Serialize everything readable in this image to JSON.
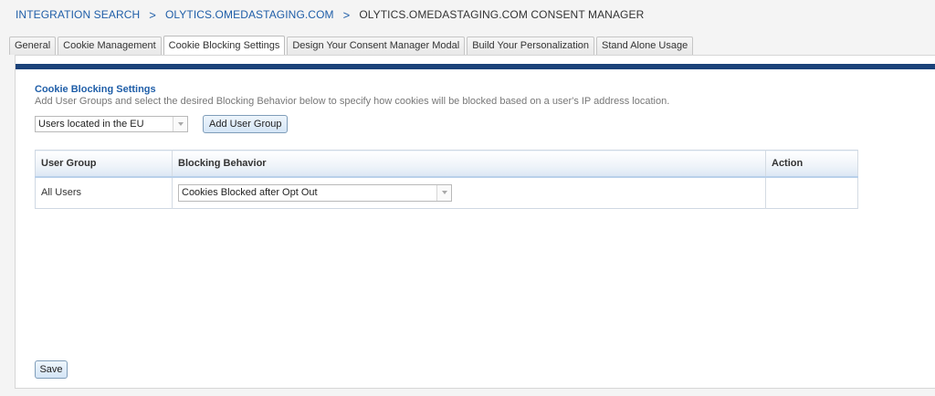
{
  "breadcrumb": {
    "items": [
      "INTEGRATION SEARCH",
      "OLYTICS.OMEDASTAGING.COM"
    ],
    "separator": ">",
    "current": "OLYTICS.OMEDASTAGING.COM CONSENT MANAGER"
  },
  "tabs": [
    {
      "label": "General",
      "active": false
    },
    {
      "label": "Cookie Management",
      "active": false
    },
    {
      "label": "Cookie Blocking Settings",
      "active": true
    },
    {
      "label": "Design Your Consent Manager Modal",
      "active": false
    },
    {
      "label": "Build Your Personalization",
      "active": false
    },
    {
      "label": "Stand Alone Usage",
      "active": false
    }
  ],
  "section": {
    "title": "Cookie Blocking Settings",
    "description": "Add User Groups and select the desired Blocking Behavior below to specify how cookies will be blocked based on a user's IP address location."
  },
  "user_group_select": {
    "value": "Users located in the EU"
  },
  "add_group_button": {
    "label": "Add User Group"
  },
  "table": {
    "columns": [
      "User Group",
      "Blocking Behavior",
      "Action"
    ],
    "rows": [
      {
        "user_group": "All Users",
        "blocking_behavior": "Cookies Blocked after Opt Out",
        "action": ""
      }
    ]
  },
  "save_button": {
    "label": "Save"
  },
  "colors": {
    "accent": "#1b4279",
    "link": "#1f5ea8"
  }
}
